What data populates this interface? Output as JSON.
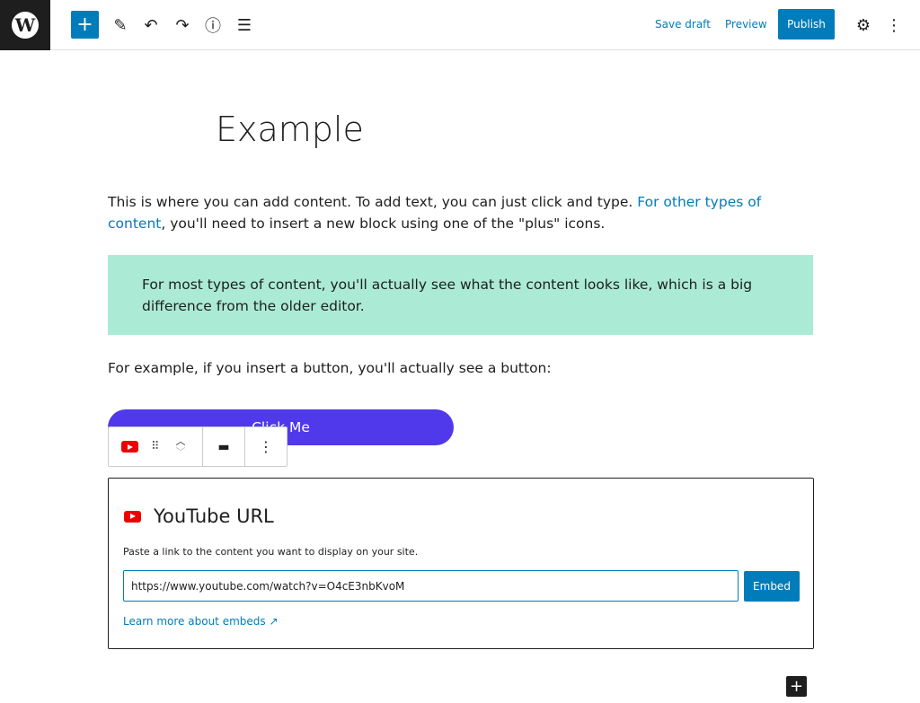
{
  "topbar": {
    "add_label": "+",
    "save_draft": "Save draft",
    "preview": "Preview",
    "publish": "Publish"
  },
  "post": {
    "title": "Example",
    "p1_before": "This is where you can add content. To add text, you can just click and type. ",
    "p1_link": "For other types of content",
    "p1_after": ", you'll need to insert a new block using one of the \"plus\" icons.",
    "quote": "For most types of content, you'll actually see what the content looks like, which is a big difference from the older editor.",
    "p2": "For example, if you insert a button, you'll actually see a button:",
    "button_label": "Click Me"
  },
  "embed": {
    "title": "YouTube URL",
    "description": "Paste a link to the content you want to display on your site.",
    "url_value": "https://www.youtube.com/watch?v=O4cE3nbKvoM",
    "embed_label": "Embed",
    "learn_more": "Learn more about embeds"
  },
  "colors": {
    "accent": "#007cba",
    "quote_bg": "#abebd5",
    "button_bg": "#5039ea",
    "youtube": "#ee0000"
  }
}
